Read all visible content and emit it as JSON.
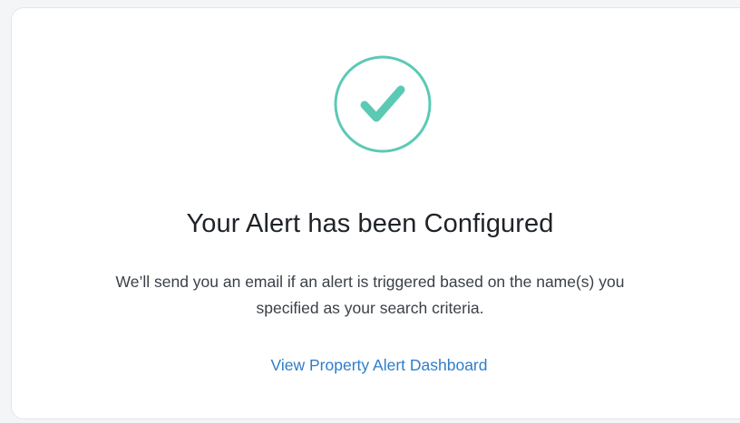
{
  "icon": {
    "name": "checkmark-circle-icon",
    "color": "#5cc9b5"
  },
  "title": "Your Alert has been Configured",
  "message": {
    "line1": "We’ll send you an email if an alert is triggered based on the name(s) you",
    "line2": "specified as your search criteria."
  },
  "link": {
    "label": "View Property Alert Dashboard",
    "color": "#2f7dc9"
  }
}
